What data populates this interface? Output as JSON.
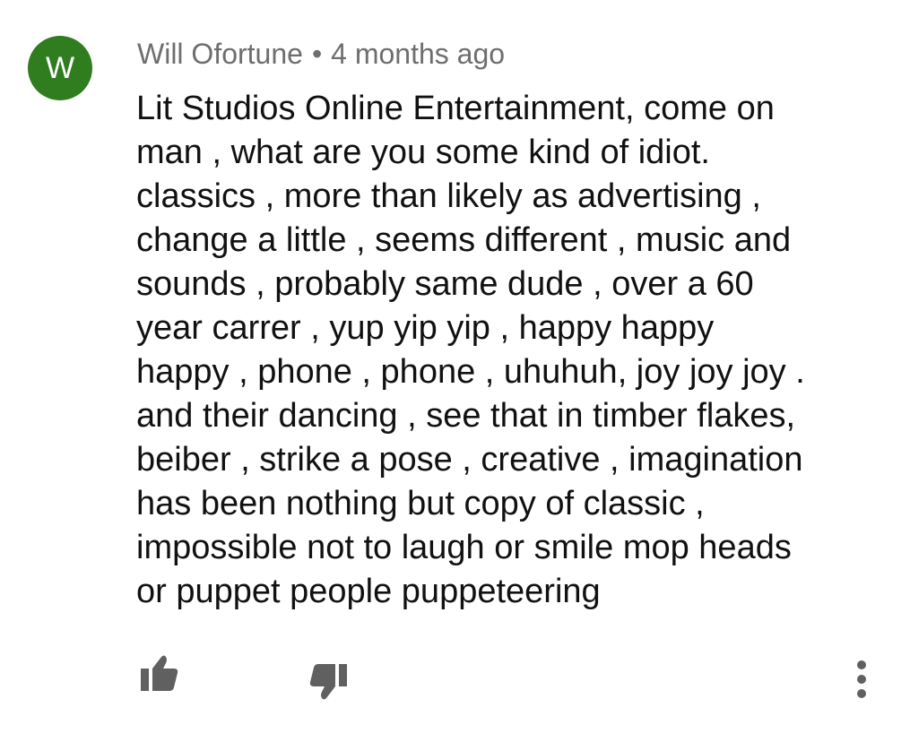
{
  "comment": {
    "avatar_letter": "W",
    "avatar_color": "#2f7d1f",
    "author": "Will Ofortune",
    "separator": "•",
    "time": "4 months ago",
    "text": "Lit Studios Online Entertainment,  come on\nman , what are you some kind of idiot.\nclassics , more than likely as advertising ,\nchange a little , seems different , music and\nsounds , probably same dude , over a 60\nyear carrer , yup yip yip , happy happy\nhappy , phone , phone , uhuhuh, joy joy joy .\nand their dancing , see that in timber flakes,\nbeiber , strike a pose , creative , imagination\nhas been nothing but copy of classic ,\nimpossible not to laugh or smile mop heads\nor puppet people puppeteering"
  },
  "actions": {
    "like_icon": "thumbs-up-icon",
    "dislike_icon": "thumbs-down-icon",
    "more_icon": "more-vertical-icon",
    "icon_color": "#606060"
  }
}
